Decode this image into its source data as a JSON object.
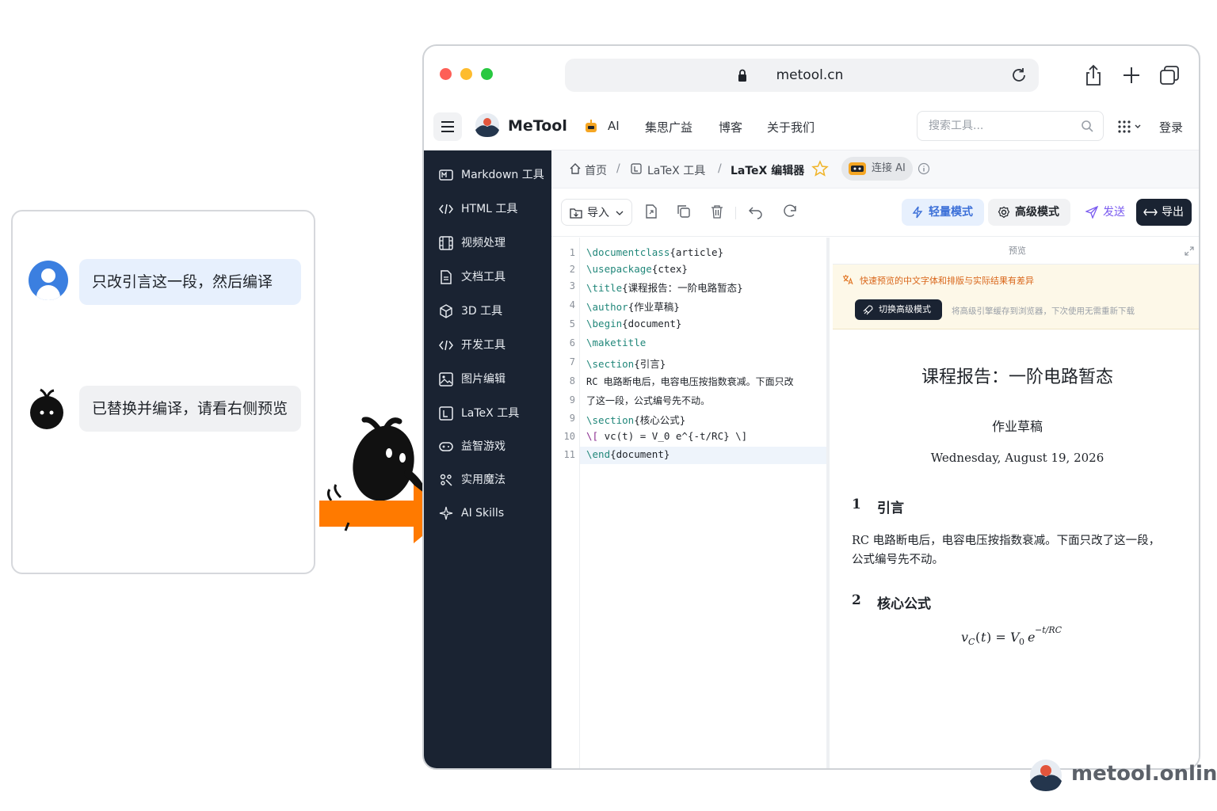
{
  "chat": {
    "user_message": "只改引言这一段，然后编译",
    "bot_message": "已替换并编译，请看右侧预览"
  },
  "browser": {
    "url": "metool.cn"
  },
  "header": {
    "brand": "MeTool",
    "nav": [
      "AI",
      "集思广益",
      "博客",
      "关于我们"
    ],
    "search_placeholder": "搜索工具...",
    "login": "登录"
  },
  "sidebar": {
    "items": [
      {
        "label": "Markdown 工具",
        "icon": "markdown-icon"
      },
      {
        "label": "HTML 工具",
        "icon": "code-icon"
      },
      {
        "label": "视频处理",
        "icon": "film-icon"
      },
      {
        "label": "文档工具",
        "icon": "document-icon"
      },
      {
        "label": "3D 工具",
        "icon": "cube-icon"
      },
      {
        "label": "开发工具",
        "icon": "code-icon"
      },
      {
        "label": "图片编辑",
        "icon": "image-icon"
      },
      {
        "label": "LaTeX 工具",
        "icon": "latex-icon"
      },
      {
        "label": "益智游戏",
        "icon": "gamepad-icon"
      },
      {
        "label": "实用魔法",
        "icon": "magic-icon"
      },
      {
        "label": "AI Skills",
        "icon": "sparkle-icon"
      }
    ]
  },
  "breadcrumb": {
    "home": "首页",
    "parent": "LaTeX 工具",
    "current": "LaTeX 编辑器",
    "ai_connect": "连接 AI"
  },
  "toolbar": {
    "import": "导入",
    "light_mode": "轻量模式",
    "advanced_mode": "高级模式",
    "send": "发送",
    "export": "导出"
  },
  "editor": {
    "line_numbers": [
      "1",
      "2",
      "3",
      "4",
      "5",
      "6",
      "7",
      "8",
      "",
      "9",
      "10",
      "11"
    ],
    "lines": [
      {
        "cmd": "\\documentclass",
        "arg": "{article}"
      },
      {
        "cmd": "\\usepackage",
        "arg": "{ctex}"
      },
      {
        "cmd": "\\title",
        "arg": "{课程报告：一阶电路暂态}"
      },
      {
        "cmd": "\\author",
        "arg": "{作业草稿}"
      },
      {
        "cmd": "\\begin",
        "arg": "{document}"
      },
      {
        "cmd": "\\maketitle",
        "arg": ""
      },
      {
        "cmd": "\\section",
        "arg": "{引言}"
      },
      {
        "cmd": "",
        "arg": "RC 电路断电后，电容电压按指数衰减。下面只改"
      },
      {
        "cmd": "",
        "arg": "了这一段，公式编号先不动。"
      },
      {
        "cmd": "\\section",
        "arg": "{核心公式}"
      },
      {
        "cmd": "\\[",
        "arg": " vc(t) = V_0 e^{-t/RC} \\]"
      },
      {
        "cmd": "\\end",
        "arg": "{document}"
      }
    ]
  },
  "preview": {
    "header": "预览",
    "warning": "快速预览的中文字体和排版与实际结果有差异",
    "switch_button": "切换高级模式",
    "switch_hint": "将高级引擎缓存到浏览器，下次使用无需重新下载",
    "doc_title": "课程报告：一阶电路暂态",
    "doc_author": "作业草稿",
    "doc_date": "Wednesday, August 19, 2026",
    "section1_num": "1",
    "section1_title": "引言",
    "section1_body_l1": "RC 电路断电后，电容电压按指数衰减。下面只改了这一段，",
    "section1_body_l2": "公式编号先不动。",
    "section2_num": "2",
    "section2_title": "核心公式"
  },
  "watermark": "metool.online",
  "colors": {
    "sidebar_bg": "#1a2332",
    "accent_blue": "#3b6fd8",
    "arrow_orange": "#ff7a00",
    "export_bg": "#1a2332"
  }
}
